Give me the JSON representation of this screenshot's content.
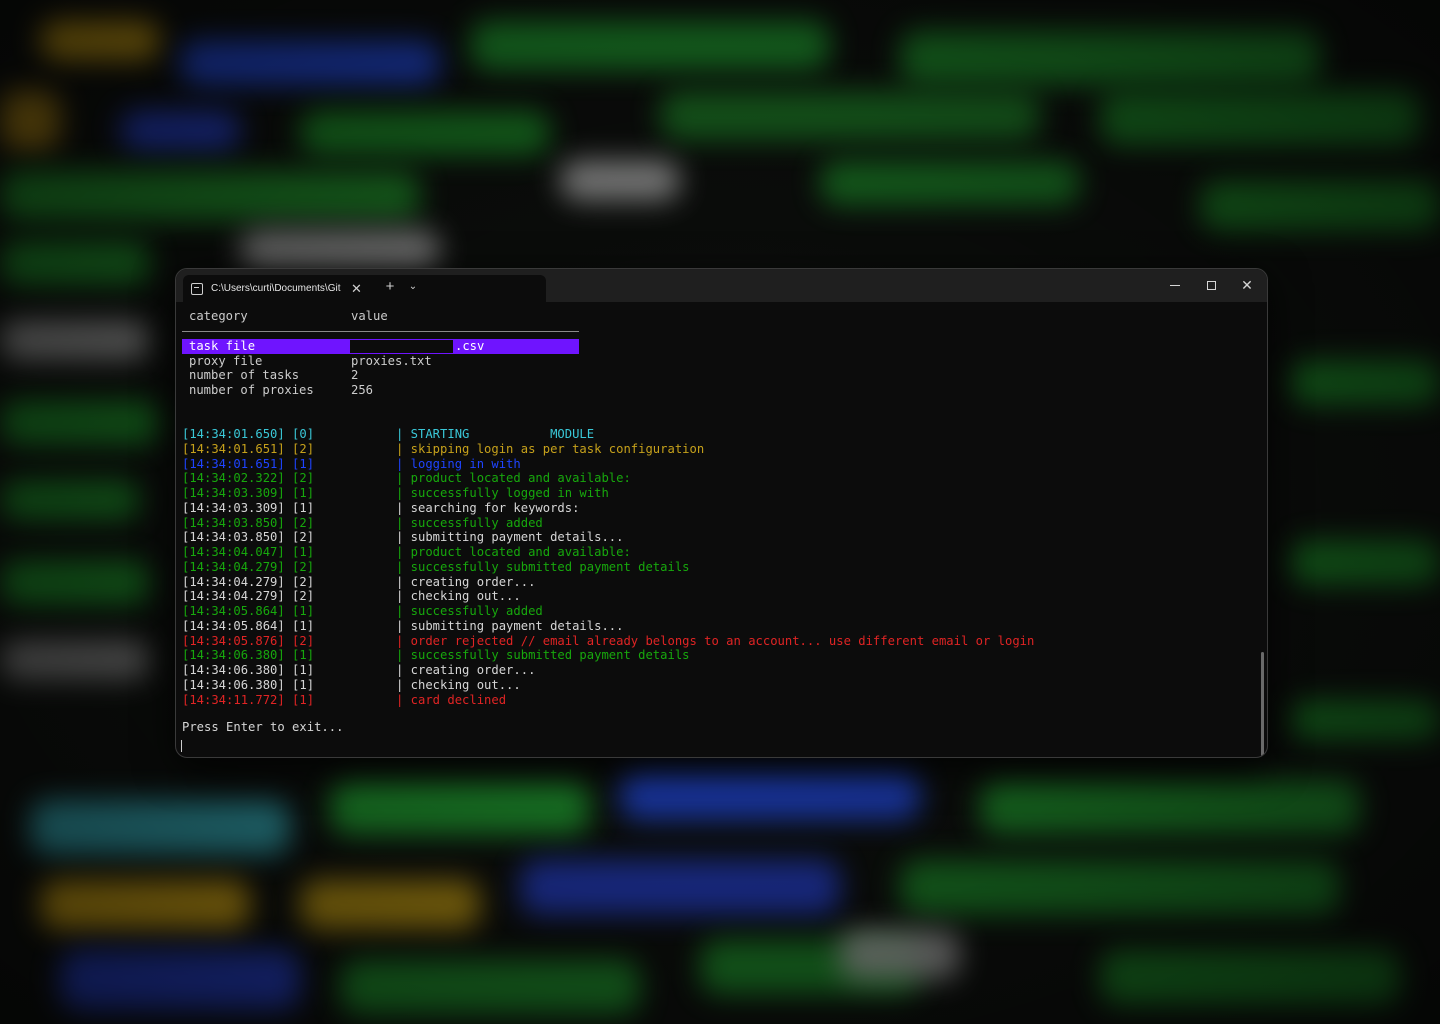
{
  "tab": {
    "title": "C:\\Users\\curti\\Documents\\Git"
  },
  "titlebar": {
    "new_tab": "+",
    "dropdown": "⌄",
    "close": "✕"
  },
  "config_table": {
    "header_category": "category",
    "header_value": "value",
    "rows": [
      {
        "category": "task file",
        "value": ".csv"
      },
      {
        "category": "proxy file",
        "value": "proxies.txt"
      },
      {
        "category": "number of tasks",
        "value": "2"
      },
      {
        "category": "number of proxies",
        "value": "256"
      }
    ]
  },
  "log": [
    {
      "ts": "[14:34:01.650] [0]",
      "msg": "| STARTING           MODULE",
      "color": "cyan"
    },
    {
      "ts": "[14:34:01.651] [2]",
      "msg": "| skipping login as per task configuration",
      "color": "yellow"
    },
    {
      "ts": "[14:34:01.651] [1]",
      "msg": "| logging in with",
      "color": "blue"
    },
    {
      "ts": "[14:34:02.322] [2]",
      "msg": "| product located and available:",
      "color": "green"
    },
    {
      "ts": "[14:34:03.309] [1]",
      "msg": "| successfully logged in with",
      "color": "green"
    },
    {
      "ts": "[14:34:03.309] [1]",
      "msg": "| searching for keywords:",
      "color": "white"
    },
    {
      "ts": "[14:34:03.850] [2]",
      "msg": "| successfully added",
      "color": "green"
    },
    {
      "ts": "[14:34:03.850] [2]",
      "msg": "| submitting payment details...",
      "color": "white"
    },
    {
      "ts": "[14:34:04.047] [1]",
      "msg": "| product located and available:",
      "color": "green"
    },
    {
      "ts": "[14:34:04.279] [2]",
      "msg": "| successfully submitted payment details",
      "color": "green"
    },
    {
      "ts": "[14:34:04.279] [2]",
      "msg": "| creating order...",
      "color": "white"
    },
    {
      "ts": "[14:34:04.279] [2]",
      "msg": "| checking out...",
      "color": "white"
    },
    {
      "ts": "[14:34:05.864] [1]",
      "msg": "| successfully added",
      "color": "green"
    },
    {
      "ts": "[14:34:05.864] [1]",
      "msg": "| submitting payment details...",
      "color": "white"
    },
    {
      "ts": "[14:34:05.876] [2]",
      "msg": "| order rejected // email already belongs to an account... use different email or login",
      "color": "red"
    },
    {
      "ts": "[14:34:06.380] [1]",
      "msg": "| successfully submitted payment details",
      "color": "green"
    },
    {
      "ts": "[14:34:06.380] [1]",
      "msg": "| creating order...",
      "color": "white"
    },
    {
      "ts": "[14:34:06.380] [1]",
      "msg": "| checking out...",
      "color": "white"
    },
    {
      "ts": "[14:34:11.772] [1]",
      "msg": "| card declined",
      "color": "red"
    }
  ],
  "prompt": "Press Enter to exit...",
  "colors": {
    "highlight": "#6f14ff",
    "cyan": "#3ac8d8",
    "yellow": "#c6a11b",
    "blue": "#1e44ff",
    "green": "#17a80d",
    "red": "#e02424"
  }
}
